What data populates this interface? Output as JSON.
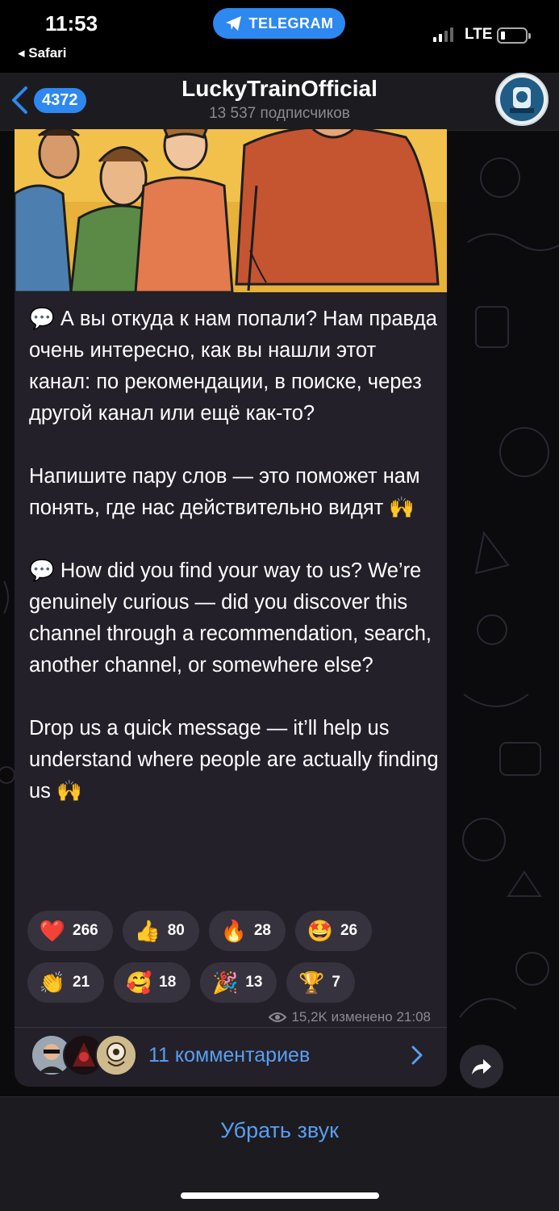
{
  "status_bar": {
    "time": "11:53",
    "back_app": "◂ Safari",
    "app_pill": "TELEGRAM",
    "network": "LTE"
  },
  "header": {
    "back_count": "4372",
    "title": "LuckyTrainOfficial",
    "subtitle": "13 537 подписчиков"
  },
  "post": {
    "message": "💬 А вы откуда к нам попали? Нам правда очень интересно, как вы нашли этот канал: по рекомендации, в поиске, через другой канал или ещё как-то?\n\nНапишите пару слов — это поможет нам понять, где нас действительно видят 🙌\n\n💬 How did you find your way to us? We’re genuinely curious — did you discover this channel through a recommendation, search, another channel, or somewhere else?\n\nDrop us a quick message — it’ll help us understand where people are actually finding us 🙌",
    "reactions_row1": [
      {
        "emoji": "❤️",
        "count": "266"
      },
      {
        "emoji": "👍",
        "count": "80"
      },
      {
        "emoji": "🔥",
        "count": "28"
      },
      {
        "emoji": "🤩",
        "count": "26"
      }
    ],
    "reactions_row2": [
      {
        "emoji": "👏",
        "count": "21"
      },
      {
        "emoji": "🥰",
        "count": "18"
      },
      {
        "emoji": "🎉",
        "count": "13"
      },
      {
        "emoji": "🏆",
        "count": "7"
      }
    ],
    "views_meta": "15,2K изменено 21:08",
    "comments_label": "11 комментариев"
  },
  "bottom": {
    "mute_label": "Убрать звук"
  },
  "colors": {
    "accent": "#2d88f0",
    "link": "#5a9ef0",
    "bubble": "#23202a"
  }
}
